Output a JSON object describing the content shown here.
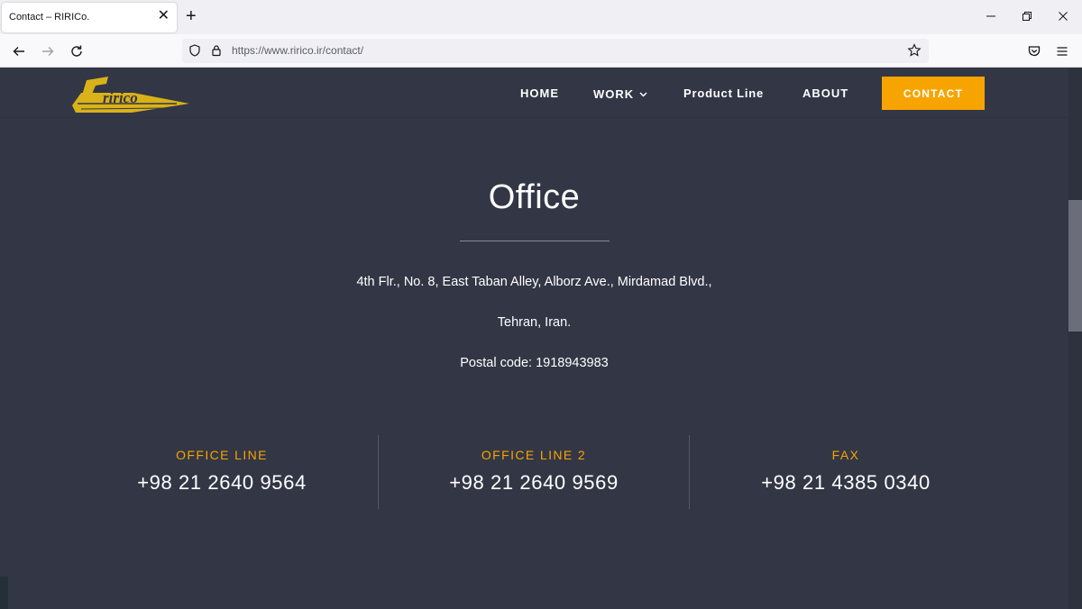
{
  "browser": {
    "tab_title": "Contact – RIRICo.",
    "tab_close": "✕",
    "new_tab": "+",
    "url": "https://www.ririco.ir/contact/",
    "icons": [
      "back-arrow-icon",
      "forward-arrow-icon",
      "reload-icon",
      "shield-icon",
      "lock-icon",
      "star-icon",
      "pocket-icon",
      "hamburger-menu-icon",
      "minimize-icon",
      "restore-icon",
      "close-icon"
    ]
  },
  "site": {
    "logo_text": "ririco",
    "menu": {
      "home": "HOME",
      "work": "WORK",
      "product_line": "Product Line",
      "about": "ABOUT",
      "contact": "CONTACT"
    },
    "office": {
      "title": "Office",
      "address_line1": "4th Flr., No. 8, East Taban Alley, Alborz Ave., Mirdamad Blvd.,",
      "address_line2": "Tehran, Iran.",
      "postal": "Postal code: 1918943983"
    },
    "contacts": [
      {
        "label": "OFFICE LINE",
        "value": "+98 21 2640 9564"
      },
      {
        "label": "OFFICE LINE 2",
        "value": "+98 21 2640 9569"
      },
      {
        "label": "FAX",
        "value": "+98 21 4385 0340"
      }
    ]
  },
  "colors": {
    "background": "#333645",
    "accent": "#f7a400",
    "logo_yellow": "#d9b21a",
    "text": "#ffffff"
  }
}
